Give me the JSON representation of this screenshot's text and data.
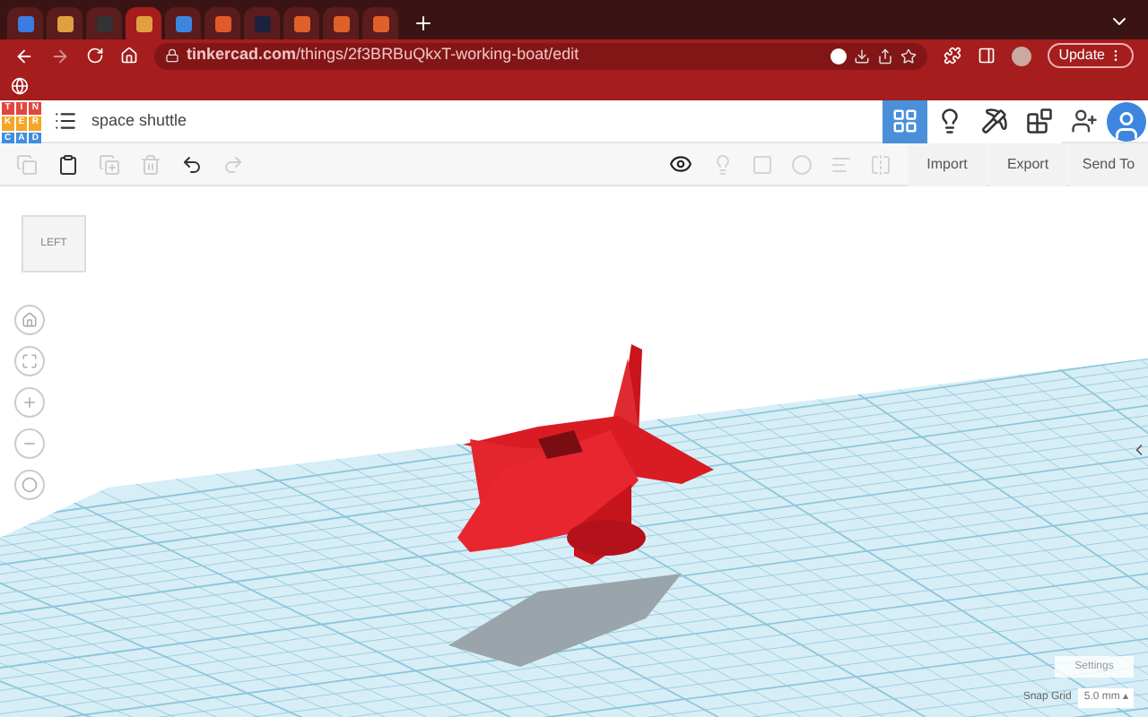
{
  "browser": {
    "tabs": [
      {
        "selected": false
      },
      {
        "selected": false
      },
      {
        "selected": false
      },
      {
        "selected": true
      },
      {
        "selected": false
      },
      {
        "selected": false
      },
      {
        "selected": false
      },
      {
        "selected": false
      },
      {
        "selected": false
      },
      {
        "selected": false
      }
    ],
    "url": "**tinkercad.com**/things/2f3BRBuQkxT-working-boat/edit",
    "update_button": "Update"
  },
  "app": {
    "logo": [
      "T",
      "I",
      "N",
      "K",
      "E",
      "R",
      "C",
      "A",
      "D"
    ],
    "design_title": "space shuttle",
    "views": [
      {
        "selected": true
      },
      {
        "selected": false
      },
      {
        "selected": false
      },
      {
        "selected": false
      }
    ]
  },
  "toolbar": {
    "edit_tools": [
      {
        "kind": "copy",
        "disabled": true
      },
      {
        "kind": "paste",
        "disabled": false
      },
      {
        "kind": "duplicate",
        "disabled": true
      },
      {
        "kind": "delete",
        "disabled": true
      },
      {
        "kind": "undo",
        "disabled": false
      },
      {
        "kind": "redo",
        "disabled": true
      }
    ],
    "actions": [
      "Import",
      "Export",
      "Send To"
    ]
  },
  "viewport": {
    "view_cube": "LEFT",
    "settings": "Settings",
    "snap_grid_label": "Snap Grid",
    "snap_grid_value": "5.0 mm ▴"
  }
}
